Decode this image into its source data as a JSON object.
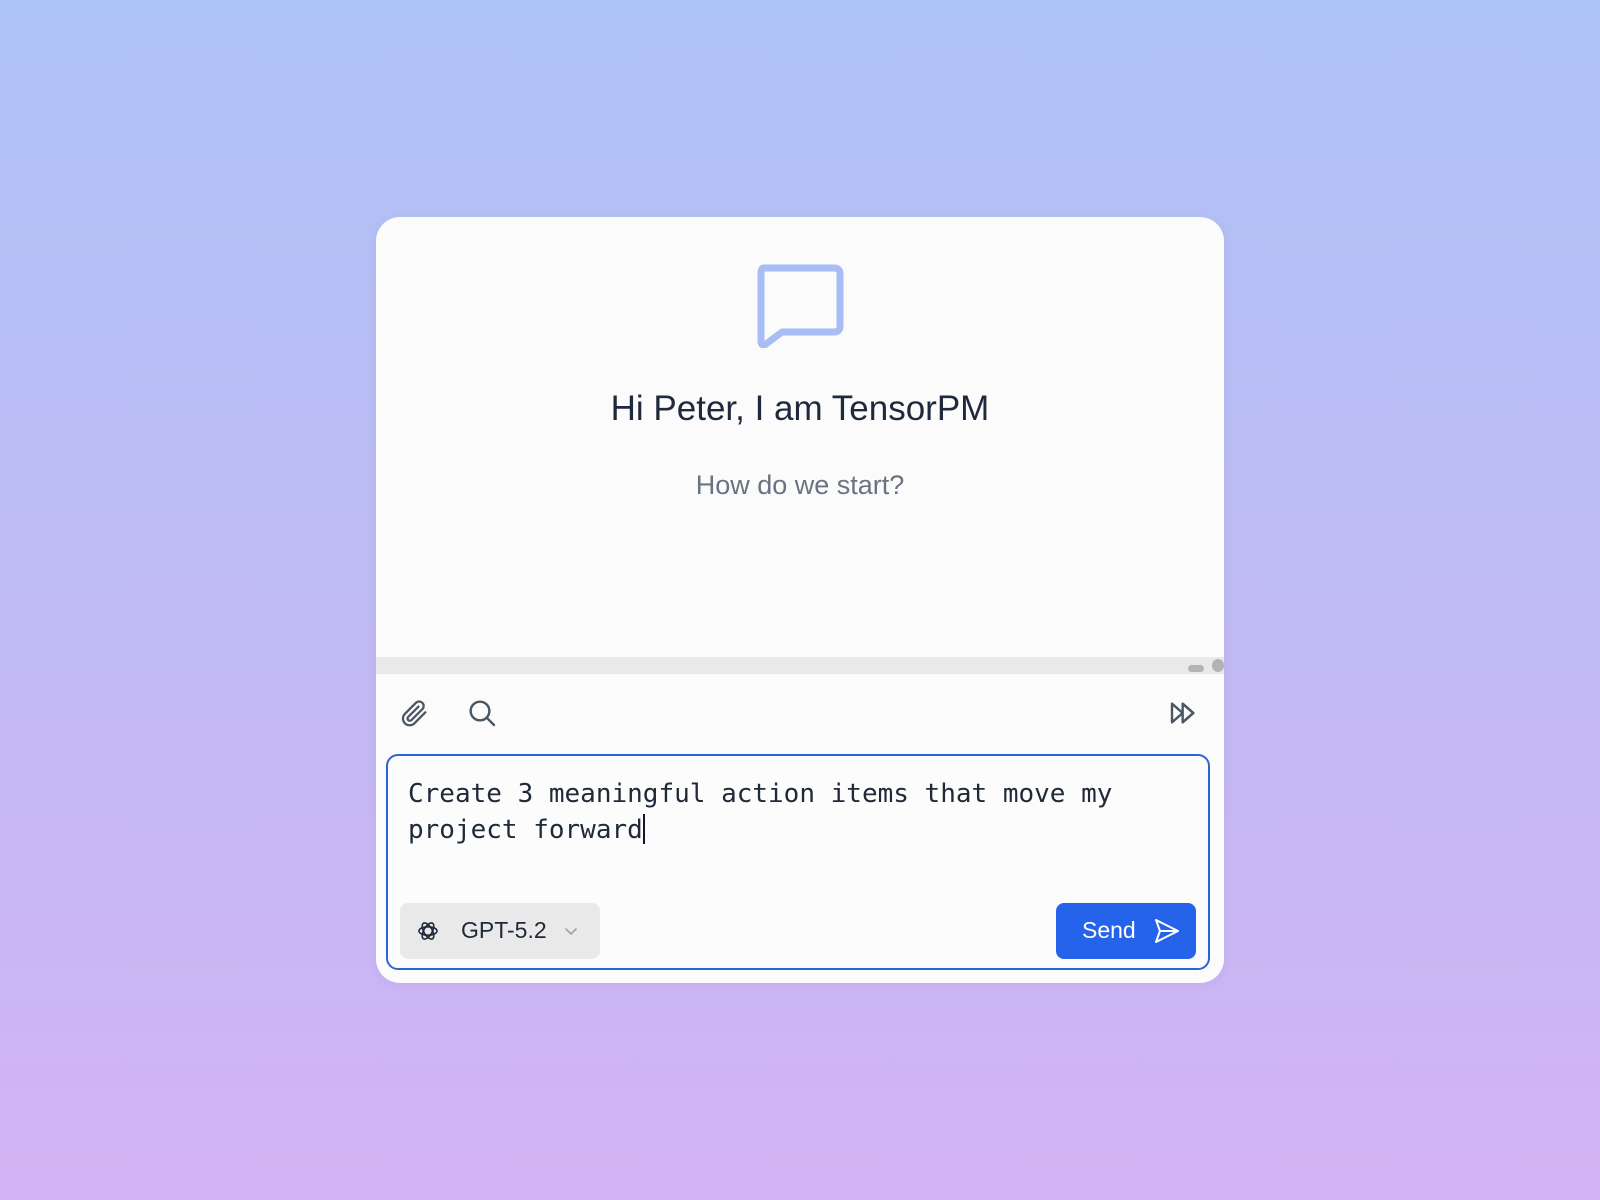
{
  "hero": {
    "icon": "chat-bubble-icon",
    "title": "Hi Peter, I am TensorPM",
    "subtitle": "How do we start?"
  },
  "toolbar": {
    "left_icons": [
      "paperclip-icon",
      "search-icon"
    ],
    "right_icons": [
      "skip-forward-icon"
    ]
  },
  "composer": {
    "value": "Create 3 meaningful action items that move my project forward",
    "model": {
      "icon": "openai-logo-icon",
      "selected": "GPT-5.2"
    },
    "send_label": "Send",
    "send_icon": "send-arrow-icon"
  },
  "colors": {
    "accent": "#2563eb",
    "icon_light": "#a7bdf3",
    "title": "#1e293b",
    "subtitle": "#6b7280",
    "card": "#fbfbfb"
  }
}
